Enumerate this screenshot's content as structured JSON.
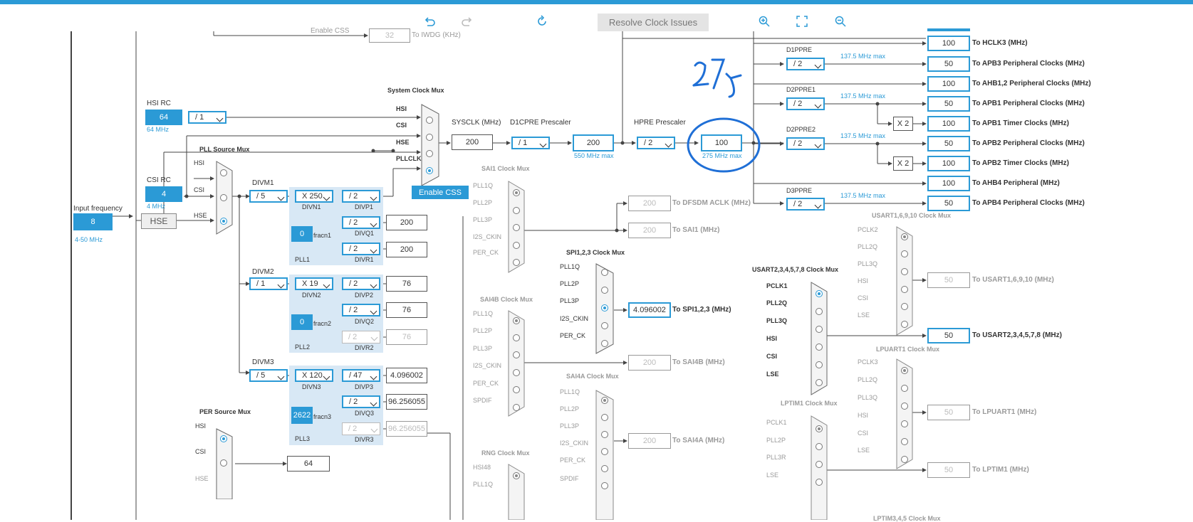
{
  "toolbar": {
    "resolve_label": "Resolve Clock Issues"
  },
  "colors": {
    "accent": "#2b9ad6",
    "pll_bg": "#d8e8f5",
    "disabled": "#9a9a9a"
  },
  "icons": [
    "undo-icon",
    "redo-icon",
    "refresh-icon",
    "zoom-in-icon",
    "fit-screen-icon",
    "zoom-out-icon"
  ],
  "iwdg": {
    "hint": "Enable CSS",
    "value": "32",
    "dest": "To IWDG (KHz)"
  },
  "hsi_rc": {
    "title": "HSI RC",
    "value": "64",
    "freq": "64 MHz",
    "div": "/ 1"
  },
  "csi_rc": {
    "title": "CSI RC",
    "value": "4",
    "freq": "4 MHz"
  },
  "input": {
    "title": "Input frequency",
    "value": "8",
    "range": "4-50 MHz",
    "hse": "HSE"
  },
  "pll_src_mux": {
    "title": "PLL Source Mux",
    "inputs": [
      "HSI",
      "CSI",
      "HSE"
    ]
  },
  "pll1": {
    "divm_title": "DIVM1",
    "divm": "/ 5",
    "divn": "X 250",
    "divn_lbl": "DIVN1",
    "frac": "0",
    "frac_lbl": "fracn1",
    "divp": "/ 2",
    "divp_lbl": "DIVP1",
    "divq": "/ 2",
    "divq_lbl": "DIVQ1",
    "divq_out": "200",
    "divr": "/ 2",
    "divr_lbl": "DIVR1",
    "divr_out": "200",
    "name": "PLL1"
  },
  "pll2": {
    "divm_title": "DIVM2",
    "divm": "/ 1",
    "divn": "X 19",
    "divn_lbl": "DIVN2",
    "frac": "0",
    "frac_lbl": "fracn2",
    "divp": "/ 2",
    "divp_lbl": "DIVP2",
    "divp_out": "76",
    "divq": "/ 2",
    "divq_lbl": "DIVQ2",
    "divq_out": "76",
    "divr": "/ 2",
    "divr_lbl": "DIVR2",
    "divr_out": "76",
    "name": "PLL2"
  },
  "pll3": {
    "divm_title": "DIVM3",
    "divm": "/ 5",
    "divn": "X 120",
    "divn_lbl": "DIVN3",
    "frac": "2622",
    "frac_lbl": "fracn3",
    "divp": "/ 47",
    "divp_lbl": "DIVP3",
    "divp_out": "4.096002",
    "divq": "/ 2",
    "divq_lbl": "DIVQ3",
    "divq_out": "96.256055",
    "divr": "/ 2",
    "divr_lbl": "DIVR3",
    "divr_out": "96.256055",
    "name": "PLL3"
  },
  "per_src_mux": {
    "title": "PER Source Mux",
    "inputs": [
      "HSI",
      "CSI",
      "HSE"
    ],
    "out": "64"
  },
  "sys_mux": {
    "title": "System Clock Mux",
    "inputs": [
      "HSI",
      "CSI",
      "HSE",
      "PLLCLK"
    ],
    "enable_css": "Enable CSS"
  },
  "sysclk": {
    "title": "SYSCLK (MHz)",
    "value": "200"
  },
  "d1cpre": {
    "title": "D1CPRE Prescaler",
    "div": "/ 1",
    "out": "200",
    "max": "550 MHz max"
  },
  "hpre": {
    "title": "HPRE Prescaler",
    "div": "/ 2",
    "out": "100",
    "max": "275 MHz max"
  },
  "annotation": "275",
  "d1ppre": {
    "title": "D1PPRE",
    "div": "/ 2",
    "max": "137.5 MHz max"
  },
  "d2ppre1": {
    "title": "D2PPRE1",
    "div": "/ 2",
    "max": "137.5 MHz max"
  },
  "d2ppre2": {
    "title": "D2PPRE2",
    "div": "/ 2",
    "max": "137.5 MHz max"
  },
  "d3ppre": {
    "title": "D3PPRE",
    "div": "/ 2",
    "max": "137.5 MHz max"
  },
  "x2": "X 2",
  "outputs": [
    {
      "value": "100",
      "label": "To HCLK3 (MHz)"
    },
    {
      "value": "50",
      "label": "To APB3 Peripheral Clocks (MHz)"
    },
    {
      "value": "100",
      "label": "To AHB1,2 Peripheral Clocks (MHz)"
    },
    {
      "value": "50",
      "label": "To APB1 Peripheral Clocks (MHz)"
    },
    {
      "value": "100",
      "label": "To APB1 Timer Clocks (MHz)"
    },
    {
      "value": "50",
      "label": "To APB2 Peripheral Clocks (MHz)"
    },
    {
      "value": "100",
      "label": "To APB2 Timer Clocks (MHz)"
    },
    {
      "value": "100",
      "label": "To AHB4 Peripheral (MHz)"
    },
    {
      "value": "50",
      "label": "To APB4 Peripheral Clocks (MHz)"
    }
  ],
  "sai1_mux": {
    "title": "SAI1 Clock Mux",
    "inputs": [
      "PLL1Q",
      "PLL2P",
      "PLL3P",
      "I2S_CKIN",
      "PER_CK"
    ],
    "out1": "200",
    "dest1": "To DFSDM ACLK (MHz)",
    "out2": "200",
    "dest2": "To SAI1 (MHz)"
  },
  "spi_mux": {
    "title": "SPI1,2,3 Clock Mux",
    "inputs": [
      "PLL1Q",
      "PLL2P",
      "PLL3P",
      "I2S_CKIN",
      "PER_CK"
    ],
    "out": "4.096002",
    "dest": "To SPI1,2,3 (MHz)"
  },
  "sai4b_mux": {
    "title": "SAI4B Clock Mux",
    "inputs": [
      "PLL1Q",
      "PLL2P",
      "PLL3P",
      "I2S_CKIN",
      "PER_CK",
      "SPDIF"
    ],
    "out": "200",
    "dest": "To SAI4B (MHz)"
  },
  "sai4a_mux": {
    "title": "SAI4A Clock Mux",
    "inputs": [
      "PLL1Q",
      "PLL2P",
      "PLL3P",
      "I2S_CKIN",
      "PER_CK",
      "SPDIF"
    ],
    "out": "200",
    "dest": "To SAI4A (MHz)"
  },
  "rng_mux": {
    "title": "RNG Clock Mux",
    "inputs": [
      "HSI48",
      "PLL1Q"
    ]
  },
  "usart16_mux": {
    "title": "USART1,6,9,10 Clock Mux",
    "inputs": [
      "PCLK2",
      "PLL2Q",
      "PLL3Q",
      "HSI",
      "CSI",
      "LSE"
    ],
    "out": "50",
    "dest": "To USART1,6,9,10 (MHz)"
  },
  "usart2_mux": {
    "title": "USART2,3,4,5,7,8 Clock Mux",
    "inputs": [
      "PCLK1",
      "PLL2Q",
      "PLL3Q",
      "HSI",
      "CSI",
      "LSE"
    ],
    "out": "50",
    "dest": "To USART2,3,4,5,7,8 (MHz)"
  },
  "lpuart_mux": {
    "title": "LPUART1 Clock Mux",
    "inputs": [
      "PCLK3",
      "PLL2Q",
      "PLL3Q",
      "HSI",
      "CSI",
      "LSE"
    ],
    "out": "50",
    "dest": "To LPUART1 (MHz)"
  },
  "lptim1_mux": {
    "title": "LPTIM1 Clock Mux",
    "inputs": [
      "PCLK1",
      "PLL2P",
      "PLL3R",
      "LSE"
    ],
    "out": "50",
    "dest": "To LPTIM1 (MHz)"
  },
  "lptim345_title": "LPTIM3,4,5 Clock Mux"
}
